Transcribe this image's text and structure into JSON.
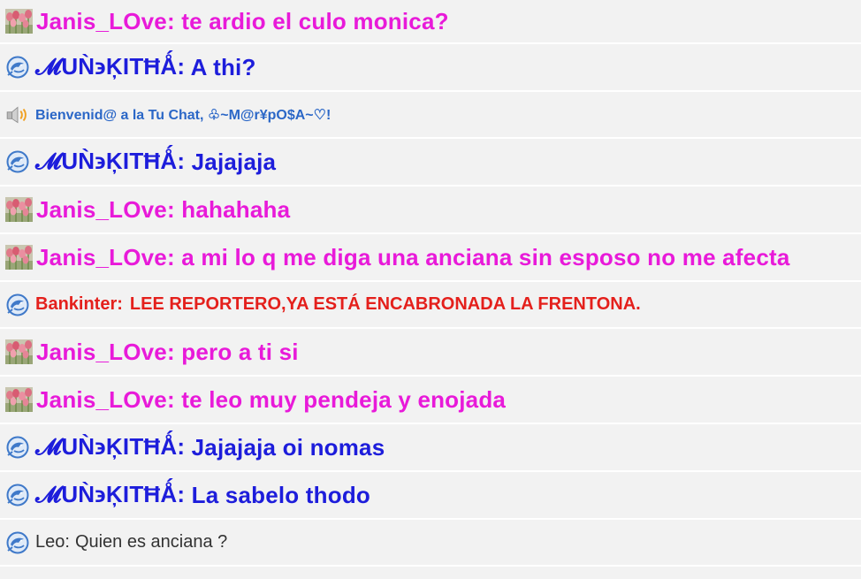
{
  "colors": {
    "pink_user": "#e81ad9",
    "blue_user": "#1d1ddb",
    "red_user": "#e4201c",
    "system": "#2b67c7",
    "gray_user": "#333333",
    "row_bg": "#f2f2f2"
  },
  "messages": [
    {
      "name": "Janis_LOve:",
      "text": " te ardio el culo monica?",
      "avatar": "tulips-avatar-icon"
    },
    {
      "name": "𝓜UǸ϶ĶITĦǺ:",
      "text": " A thi?",
      "avatar": "dolphin-avatar-icon"
    },
    {
      "name": "",
      "text": "Bienvenid@ a la Tu Chat, ♧~M@r¥pO$A~♡!",
      "avatar": "speaker-icon"
    },
    {
      "name": "𝓜UǸ϶ĶITĦǺ:",
      "text": " Jajajaja",
      "avatar": "dolphin-avatar-icon"
    },
    {
      "name": "Janis_LOve:",
      "text": " hahahaha",
      "avatar": "tulips-avatar-icon"
    },
    {
      "name": "Janis_LOve:",
      "text": " a mi lo q me diga una anciana sin esposo no me afecta",
      "avatar": "tulips-avatar-icon"
    },
    {
      "name": "Bankinter:",
      "text": "LEE REPORTERO,YA ESTÁ ENCABRONADA LA FRENTONA.",
      "avatar": "dolphin-avatar-icon"
    },
    {
      "name": "Janis_LOve:",
      "text": " pero a ti si",
      "avatar": "tulips-avatar-icon"
    },
    {
      "name": "Janis_LOve:",
      "text": " te leo muy pendeja y enojada",
      "avatar": "tulips-avatar-icon"
    },
    {
      "name": "𝓜UǸ϶ĶITĦǺ:",
      "text": " Jajajaja oi nomas",
      "avatar": "dolphin-avatar-icon"
    },
    {
      "name": "𝓜UǸ϶ĶITĦǺ:",
      "text": " La sabelo thodo",
      "avatar": "dolphin-avatar-icon"
    },
    {
      "name": "Leo:",
      "text": "Quien es anciana ?",
      "avatar": "dolphin-avatar-icon"
    }
  ]
}
